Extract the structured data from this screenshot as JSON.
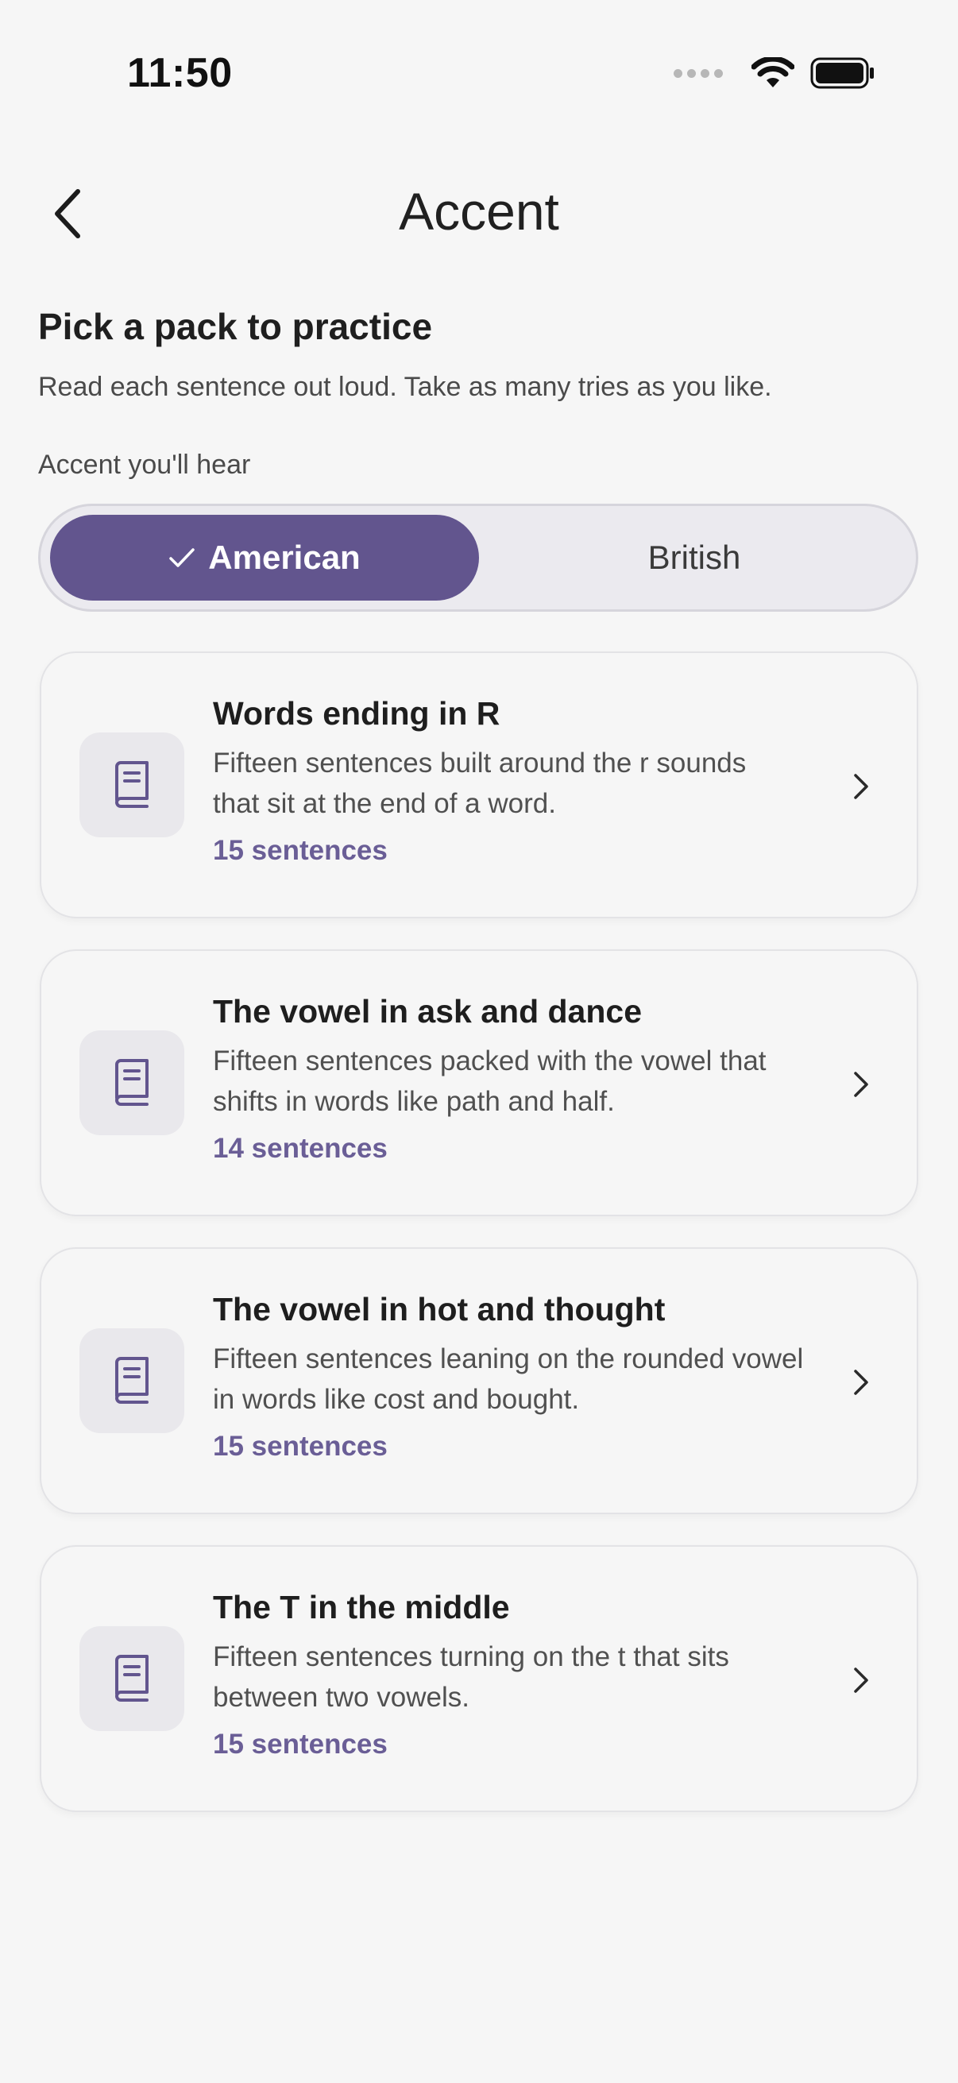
{
  "status_bar": {
    "time": "11:50"
  },
  "header": {
    "title": "Accent"
  },
  "intro": {
    "title": "Pick a pack to practice",
    "subtitle": "Read each sentence out loud. Take as many tries as you like."
  },
  "accent_toggle": {
    "label": "Accent you'll hear",
    "options": [
      {
        "label": "American",
        "selected": true
      },
      {
        "label": "British",
        "selected": false
      }
    ]
  },
  "packs": [
    {
      "title": "Words ending in R",
      "description_lines": [
        "Fifteen sentences built around the r sounds",
        "that sit at the end of a word."
      ],
      "count": "15 sentences"
    },
    {
      "title": "The vowel in ask and dance",
      "description_lines": [
        "Fifteen sentences packed with the vowel that",
        "shifts in words like path and half."
      ],
      "count": "14 sentences"
    },
    {
      "title": "The vowel in hot and thought",
      "description_lines": [
        "Fifteen sentences leaning on the rounded vowel",
        "in words like cost and bought."
      ],
      "count": "15 sentences"
    },
    {
      "title": "The T in the middle",
      "description_lines": [
        "Fifteen sentences turning on the t that sits",
        "between two vowels."
      ],
      "count": "15 sentences"
    }
  ],
  "icons": {
    "back": "chevron-left-icon",
    "check": "check-icon",
    "pack": "book-icon",
    "open": "chevron-right-icon",
    "wifi": "wifi-icon",
    "battery": "battery-icon",
    "signal": "signal-icon"
  },
  "colors": {
    "accent": "#62558e",
    "count_text": "#6a5e96",
    "background": "#f6f6f6"
  }
}
